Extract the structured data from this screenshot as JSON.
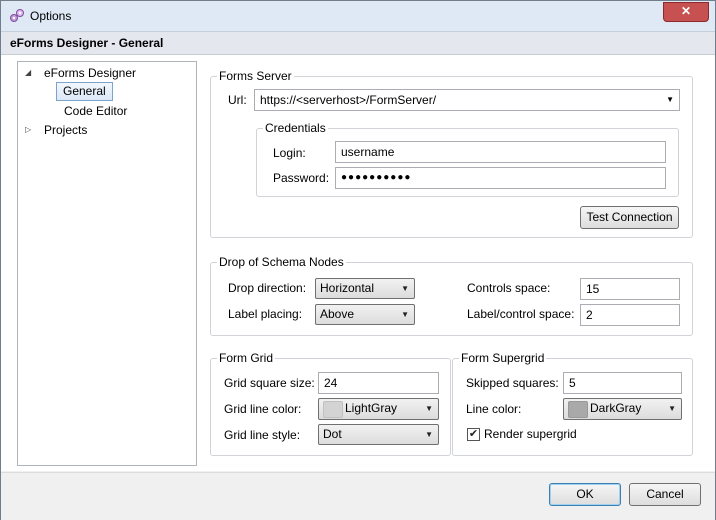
{
  "window": {
    "title": "Options",
    "close_glyph": "✕"
  },
  "header": {
    "title": "eForms Designer - General"
  },
  "tree": {
    "items": [
      {
        "label": "eForms Designer",
        "arrow": "◢"
      },
      {
        "label": "General"
      },
      {
        "label": "Code Editor"
      },
      {
        "label": "Projects",
        "arrow": "▷"
      }
    ]
  },
  "forms_server": {
    "title": "Forms Server",
    "url_label": "Url:",
    "url_value": "https://<serverhost>/FormServer/",
    "credentials": {
      "title": "Credentials",
      "login_label": "Login:",
      "login_value": "username",
      "password_label": "Password:",
      "password_value": "●●●●●●●●●●"
    },
    "test_button": "Test Connection"
  },
  "drop_schema": {
    "title": "Drop of Schema Nodes",
    "drop_direction_label": "Drop direction:",
    "drop_direction_value": "Horizontal",
    "label_placing_label": "Label placing:",
    "label_placing_value": "Above",
    "controls_space_label": "Controls space:",
    "controls_space_value": "15",
    "label_control_space_label": "Label/control space:",
    "label_control_space_value": "2"
  },
  "form_grid": {
    "title": "Form Grid",
    "square_size_label": "Grid square size:",
    "square_size_value": "24",
    "line_color_label": "Grid line color:",
    "line_color_value": "LightGray",
    "line_color_hex": "#d3d3d3",
    "line_style_label": "Grid line style:",
    "line_style_value": "Dot"
  },
  "form_supergrid": {
    "title": "Form Supergrid",
    "skipped_label": "Skipped squares:",
    "skipped_value": "5",
    "line_color_label": "Line color:",
    "line_color_value": "DarkGray",
    "line_color_hex": "#a9a9a9",
    "render_label": "Render supergrid",
    "render_checked": true
  },
  "footer": {
    "ok": "OK",
    "cancel": "Cancel"
  },
  "colors": {
    "accent": "#3c7fb1",
    "selection": "#7da2ce"
  }
}
